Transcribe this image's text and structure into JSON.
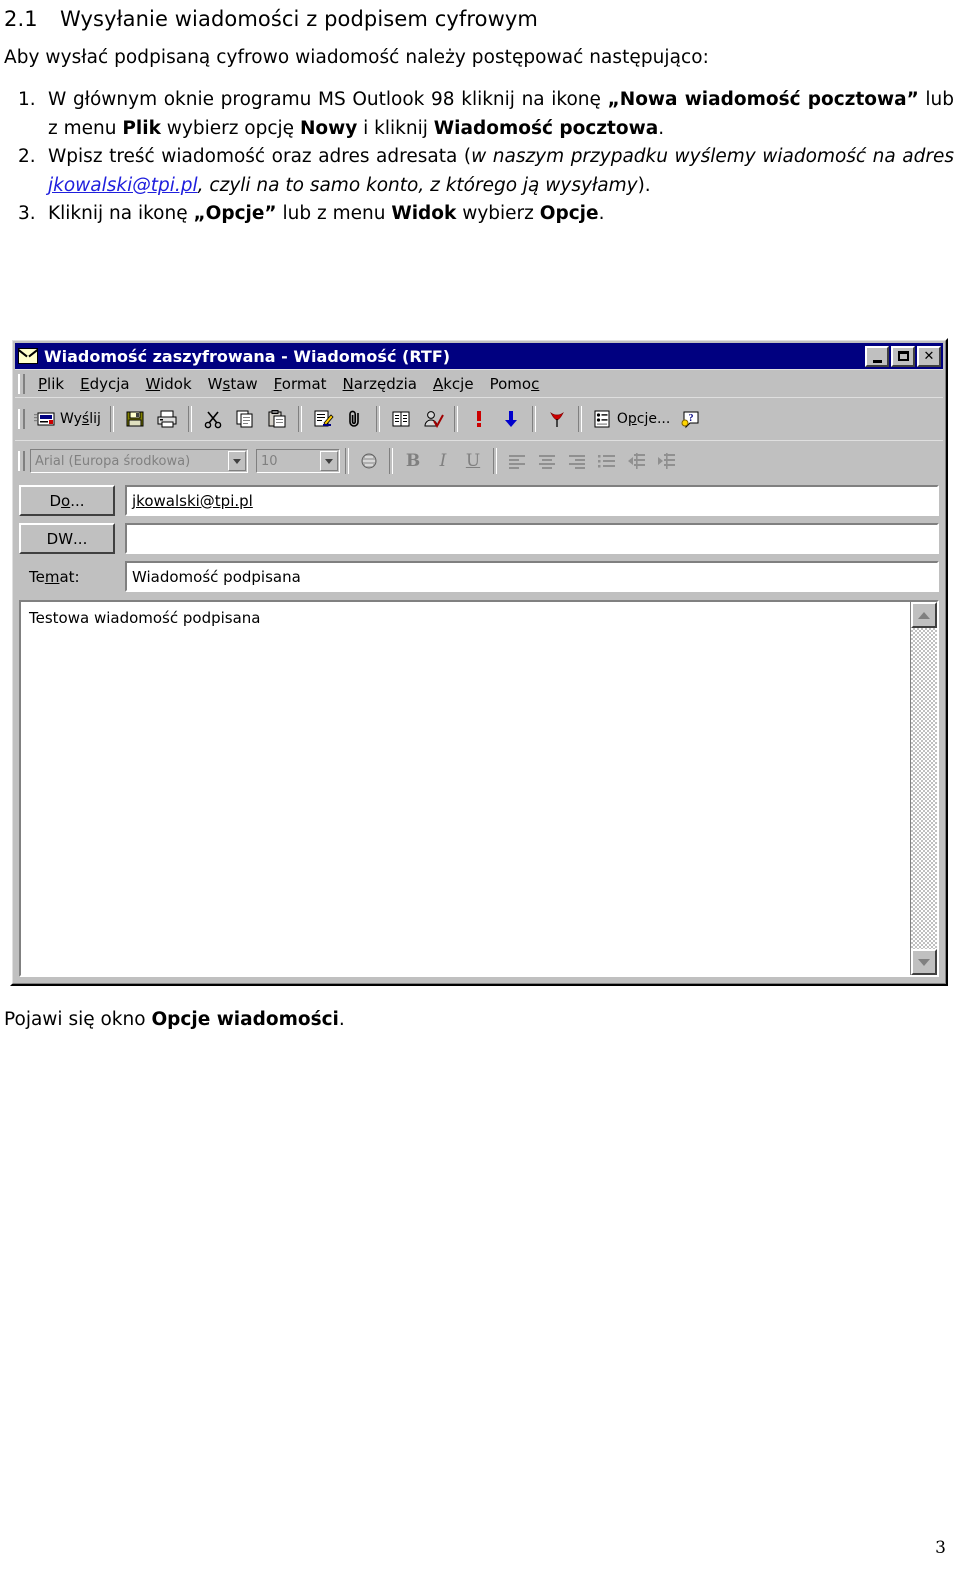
{
  "document": {
    "section_number": "2.1",
    "section_title": "Wysyłanie wiadomości z podpisem cyfrowym",
    "intro": "Aby wysłać podpisaną cyfrowo wiadomość należy postępować następująco:",
    "steps": [
      {
        "number": "1.",
        "parts": [
          {
            "text": "W głównym oknie programu MS Outlook 98 kliknij na ikonę ",
            "style": "normal"
          },
          {
            "text": "„Nowa wiadomość pocztowa”",
            "style": "bold"
          },
          {
            "text": " lub z menu ",
            "style": "normal"
          },
          {
            "text": "Plik",
            "style": "bold"
          },
          {
            "text": " wybierz opcję ",
            "style": "normal"
          },
          {
            "text": "Nowy",
            "style": "bold"
          },
          {
            "text": " i kliknij ",
            "style": "normal"
          },
          {
            "text": "Wiadomość pocztowa",
            "style": "bold"
          },
          {
            "text": ".",
            "style": "normal"
          }
        ]
      },
      {
        "number": "2.",
        "parts": [
          {
            "text": "Wpisz treść wiadomość oraz adres adresata (",
            "style": "normal"
          },
          {
            "text": "w naszym przypadku wyślemy wiadomość na adres ",
            "style": "italic"
          },
          {
            "text": "jkowalski@tpi.pl",
            "style": "link"
          },
          {
            "text": ", czyli na to samo konto, z którego ją wysyłamy",
            "style": "italic"
          },
          {
            "text": ").",
            "style": "normal"
          }
        ]
      },
      {
        "number": "3.",
        "parts": [
          {
            "text": "Kliknij na ikonę ",
            "style": "normal"
          },
          {
            "text": "„Opcje”",
            "style": "bold"
          },
          {
            "text": " lub z menu ",
            "style": "normal"
          },
          {
            "text": "Widok",
            "style": "bold"
          },
          {
            "text": " wybierz ",
            "style": "normal"
          },
          {
            "text": "Opcje",
            "style": "bold"
          },
          {
            "text": ".",
            "style": "normal"
          }
        ]
      }
    ],
    "closing_parts": [
      {
        "text": "Pojawi się okno ",
        "style": "normal"
      },
      {
        "text": "Opcje wiadomości",
        "style": "bold"
      },
      {
        "text": ".",
        "style": "normal"
      }
    ],
    "page_number": "3"
  },
  "screenshot": {
    "window": {
      "icon_name": "envelope-icon",
      "title": "Wiadomość zaszyfrowana - Wiadomość (RTF)",
      "titlebar_color": "#000080",
      "face_color": "#c0c0c0",
      "controls": [
        {
          "name": "minimize-button",
          "glyph": ""
        },
        {
          "name": "maximize-button",
          "glyph": ""
        },
        {
          "name": "close-button",
          "glyph": "✕"
        }
      ]
    },
    "menu": [
      {
        "label": "Plik",
        "accel": "P",
        "pre": "",
        "post": "lik"
      },
      {
        "label": "Edycja",
        "accel": "E",
        "pre": "",
        "post": "dycja"
      },
      {
        "label": "Widok",
        "accel": "W",
        "pre": "",
        "post": "idok"
      },
      {
        "label": "Wstaw",
        "accel": "s",
        "pre": "W",
        "post": "taw"
      },
      {
        "label": "Format",
        "accel": "F",
        "pre": "",
        "post": "ormat"
      },
      {
        "label": "Narzędzia",
        "accel": "N",
        "pre": "",
        "post": "arzędzia"
      },
      {
        "label": "Akcje",
        "accel": "A",
        "pre": "",
        "post": "kcje"
      },
      {
        "label": "Pomoc",
        "accel": "c",
        "pre": "Pomo",
        "post": ""
      }
    ],
    "toolbar": {
      "send_label_pre": "Wy",
      "send_label_accel": "ś",
      "send_label_post": "lij",
      "send_name": "send-button",
      "options_label_pre": "O",
      "options_label_accel": "p",
      "options_label_post": "cje...",
      "buttons": [
        {
          "name": "send-button",
          "icon": "send-envelope-icon",
          "label": "Wyślij"
        },
        {
          "name": "save-button",
          "icon": "floppy-disk-icon",
          "label": ""
        },
        {
          "name": "print-button",
          "icon": "printer-icon",
          "label": ""
        },
        {
          "name": "cut-button",
          "icon": "scissors-icon",
          "label": ""
        },
        {
          "name": "copy-button",
          "icon": "copy-pages-icon",
          "label": ""
        },
        {
          "name": "paste-button",
          "icon": "clipboard-icon",
          "label": ""
        },
        {
          "name": "signature-button",
          "icon": "document-pen-icon",
          "label": ""
        },
        {
          "name": "attach-file-button",
          "icon": "paperclip-icon",
          "label": ""
        },
        {
          "name": "address-book-button",
          "icon": "address-book-icon",
          "label": ""
        },
        {
          "name": "check-names-button",
          "icon": "check-names-icon",
          "label": ""
        },
        {
          "name": "high-importance-button",
          "icon": "exclamation-icon",
          "label": ""
        },
        {
          "name": "low-importance-button",
          "icon": "blue-down-arrow-icon",
          "label": ""
        },
        {
          "name": "flag-message-button",
          "icon": "red-flag-icon",
          "label": ""
        },
        {
          "name": "options-button",
          "icon": "options-list-icon",
          "label": "Opcje..."
        },
        {
          "name": "help-button",
          "icon": "help-question-icon",
          "label": ""
        }
      ]
    },
    "format_toolbar": {
      "font_name": "Arial (Europa środkowa)",
      "font_size": "10",
      "buttons": [
        {
          "name": "font-color-button",
          "icon": "font-color-icon",
          "glyph": ""
        },
        {
          "name": "bold-button",
          "icon": "bold-icon",
          "glyph": "B"
        },
        {
          "name": "italic-button",
          "icon": "italic-icon",
          "glyph": "I"
        },
        {
          "name": "underline-button",
          "icon": "underline-icon",
          "glyph": "U"
        },
        {
          "name": "align-left-button",
          "icon": "align-left-icon",
          "glyph": ""
        },
        {
          "name": "align-center-button",
          "icon": "align-center-icon",
          "glyph": ""
        },
        {
          "name": "align-right-button",
          "icon": "align-right-icon",
          "glyph": ""
        },
        {
          "name": "bullet-list-button",
          "icon": "bullet-list-icon",
          "glyph": ""
        },
        {
          "name": "decrease-indent-button",
          "icon": "decrease-indent-icon",
          "glyph": ""
        },
        {
          "name": "increase-indent-button",
          "icon": "increase-indent-icon",
          "glyph": ""
        }
      ]
    },
    "fields": {
      "to_button_pre": "D",
      "to_button_accel": "o",
      "to_button_post": "...",
      "to_button_label": "Do...",
      "to_value": "jkowalski@tpi.pl",
      "cc_button_pre": "DW",
      "cc_button_accel": "",
      "cc_button_post": "...",
      "cc_button_label": "DW...",
      "cc_value": "",
      "subject_label_pre": "Te",
      "subject_label_accel": "m",
      "subject_label_post": "at:",
      "subject_label": "Temat:",
      "subject_value": "Wiadomość podpisana"
    },
    "body": {
      "text": "Testowa wiadomość podpisana"
    },
    "scrollbar": {
      "up_name": "scroll-up-button",
      "down_name": "scroll-down-button",
      "track_name": "scroll-track"
    }
  }
}
